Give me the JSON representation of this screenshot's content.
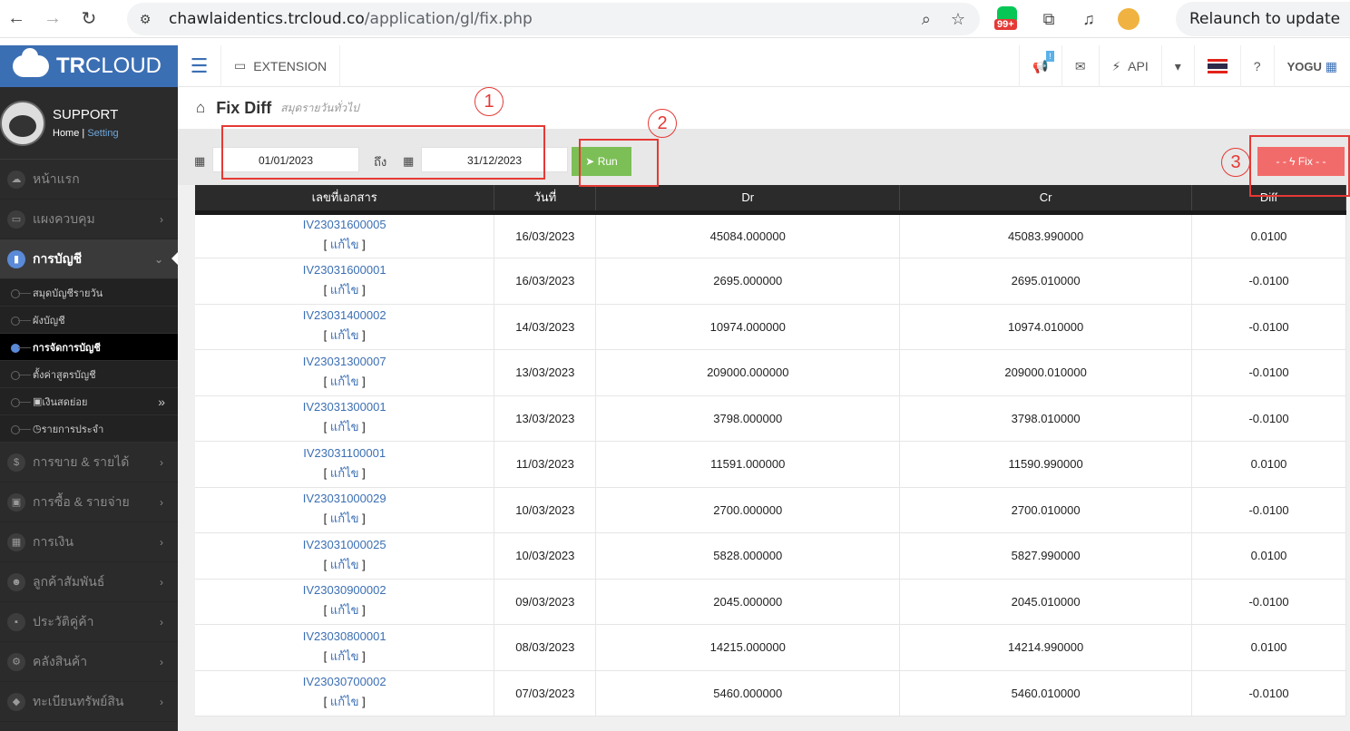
{
  "browser": {
    "url_host": "chawlaidentics.trcloud.co",
    "url_path": "/application/gl/fix.php",
    "line_badge": "99+",
    "relaunch_label": "Relaunch to update"
  },
  "sidebar": {
    "logo_bold": "TR",
    "logo_rest": "CLOUD",
    "user_name": "SUPPORT",
    "home_link": "Home",
    "setting_link": "Setting",
    "menu": [
      {
        "label": "หน้าแรก",
        "icon": "☁"
      },
      {
        "label": "แผงควบคุม",
        "icon": "▭"
      },
      {
        "label": "การบัญชี",
        "icon": "▮"
      }
    ],
    "sub_items": [
      {
        "label": "สมุดบัญชีรายวัน"
      },
      {
        "label": "ผังบัญชี"
      },
      {
        "label": "การจัดการบัญชี"
      },
      {
        "label": "ตั้งค่าสูตรบัญชี"
      },
      {
        "label": "เงินสดย่อย"
      },
      {
        "label": "รายการประจำ"
      }
    ],
    "menu2": [
      {
        "label": "การขาย & รายได้",
        "icon": "$"
      },
      {
        "label": "การซื้อ & รายจ่าย",
        "icon": "▣"
      },
      {
        "label": "การเงิน",
        "icon": "▦"
      },
      {
        "label": "ลูกค้าสัมพันธ์",
        "icon": "☻"
      },
      {
        "label": "ประวัติคู่ค้า",
        "icon": "▪"
      },
      {
        "label": "คลังสินค้า",
        "icon": "⚙"
      },
      {
        "label": "ทะเบียนทรัพย์สิน",
        "icon": "◆"
      }
    ]
  },
  "topnav": {
    "extension_label": "EXTENSION",
    "api_label": "API",
    "notif_badge": "!",
    "user_label": "YOGU"
  },
  "page": {
    "title": "Fix Diff",
    "subtitle": "สมุดรายวันทั่วไป",
    "date_from": "01/01/2023",
    "to_label": "ถึง",
    "date_to": "31/12/2023",
    "run_label": "Run",
    "fix_label": "- - ϟ Fix - -"
  },
  "table": {
    "headers": [
      "เลขที่เอกสาร",
      "วันที่",
      "Dr",
      "Cr",
      "Diff"
    ],
    "edit_label": "แก้ไข",
    "rows": [
      {
        "doc": "IV23031600005",
        "date": "16/03/2023",
        "dr": "45084.000000",
        "cr": "45083.990000",
        "diff": "0.0100"
      },
      {
        "doc": "IV23031600001",
        "date": "16/03/2023",
        "dr": "2695.000000",
        "cr": "2695.010000",
        "diff": "-0.0100"
      },
      {
        "doc": "IV23031400002",
        "date": "14/03/2023",
        "dr": "10974.000000",
        "cr": "10974.010000",
        "diff": "-0.0100"
      },
      {
        "doc": "IV23031300007",
        "date": "13/03/2023",
        "dr": "209000.000000",
        "cr": "209000.010000",
        "diff": "-0.0100"
      },
      {
        "doc": "IV23031300001",
        "date": "13/03/2023",
        "dr": "3798.000000",
        "cr": "3798.010000",
        "diff": "-0.0100"
      },
      {
        "doc": "IV23031100001",
        "date": "11/03/2023",
        "dr": "11591.000000",
        "cr": "11590.990000",
        "diff": "0.0100"
      },
      {
        "doc": "IV23031000029",
        "date": "10/03/2023",
        "dr": "2700.000000",
        "cr": "2700.010000",
        "diff": "-0.0100"
      },
      {
        "doc": "IV23031000025",
        "date": "10/03/2023",
        "dr": "5828.000000",
        "cr": "5827.990000",
        "diff": "0.0100"
      },
      {
        "doc": "IV23030900002",
        "date": "09/03/2023",
        "dr": "2045.000000",
        "cr": "2045.010000",
        "diff": "-0.0100"
      },
      {
        "doc": "IV23030800001",
        "date": "08/03/2023",
        "dr": "14215.000000",
        "cr": "14214.990000",
        "diff": "0.0100"
      },
      {
        "doc": "IV23030700002",
        "date": "07/03/2023",
        "dr": "5460.000000",
        "cr": "5460.010000",
        "diff": "-0.0100"
      }
    ]
  },
  "annotations": [
    "1",
    "2",
    "3"
  ]
}
